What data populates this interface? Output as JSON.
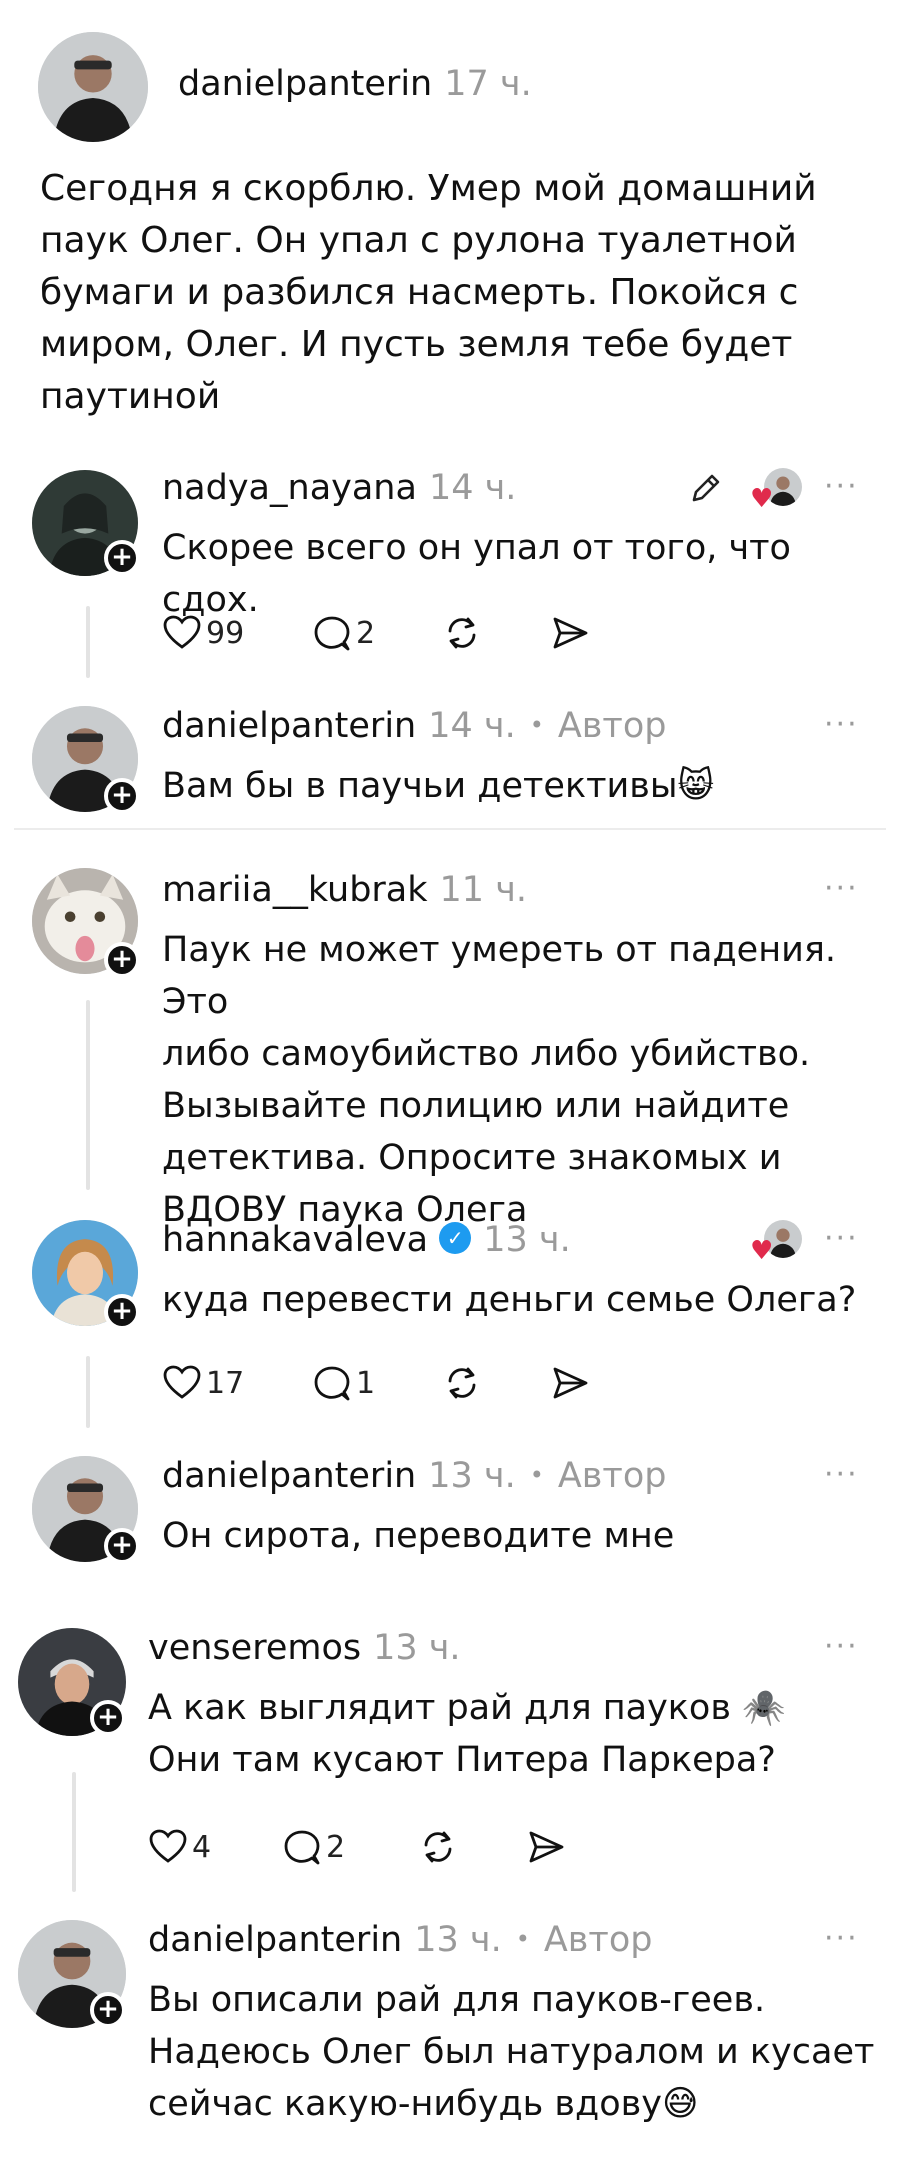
{
  "post": {
    "username": "danielpanterin",
    "time": "17 ч.",
    "text_lines": [
      "Сегодня я скорблю. Умер мой домашний",
      "паук Олег. Он упал с рулона туалетной",
      "бумаги и разбился насмерть. Покойся с",
      "миром, Олег. И пусть земля тебе будет",
      "паутиной"
    ]
  },
  "comments": [
    {
      "username": "nadya_nayana",
      "time": "14 ч.",
      "author_label": "",
      "text_lines": [
        "Скорее всего он упал от того, что сдох."
      ],
      "likes": "99",
      "replies": "2"
    },
    {
      "username": "danielpanterin",
      "time": "14 ч.",
      "author_label": "Автор",
      "text_lines": [
        "Вам бы в паучьи детективы😸"
      ]
    },
    {
      "username": "mariia__kubrak",
      "time": "11 ч.",
      "author_label": "",
      "text_lines": [
        "Паук не может умереть от падения. Это",
        "либо самоубийство либо убийство.",
        "Вызывайте полицию или найдите",
        "детектива. Опросите знакомых и",
        "ВДОВУ паука Олега"
      ]
    },
    {
      "username": "hannakavaleva",
      "time": "13 ч.",
      "author_label": "",
      "text_lines": [
        "куда перевести деньги семье Олега?"
      ],
      "likes": "17",
      "replies": "1"
    },
    {
      "username": "danielpanterin",
      "time": "13 ч.",
      "author_label": "Автор",
      "text_lines": [
        "Он сирота, переводите мне"
      ]
    },
    {
      "username": "venseremos",
      "time": "13 ч.",
      "author_label": "",
      "text_lines": [
        "А как выглядит рай для пауков 🕷️",
        "Они там кусают Питера Паркера?"
      ],
      "likes": "4",
      "replies": "2"
    },
    {
      "username": "danielpanterin",
      "time": "13 ч.",
      "author_label": "Автор",
      "text_lines": [
        "Вы описали рай для пауков-геев.",
        "Надеюсь Олег был натуралом и кусает",
        "сейчас какую-нибудь вдову😅"
      ]
    }
  ],
  "ui": {
    "dot_separator": "•",
    "more_glyph": "···",
    "plus_glyph": "+",
    "heart_glyph": "♥",
    "verified_glyph": "✓",
    "accent_verified": "#1d9bf0",
    "accent_heart": "#e02a4c"
  },
  "icons": [
    "heart-icon",
    "comment-icon",
    "repost-icon",
    "share-icon",
    "more-icon",
    "edit-icon",
    "follow-plus-icon",
    "verified-icon"
  ]
}
